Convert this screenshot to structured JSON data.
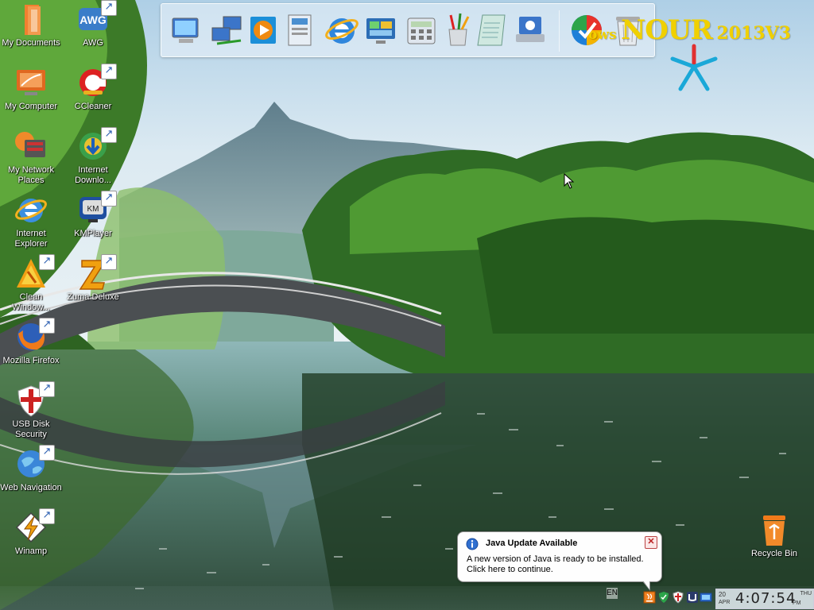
{
  "desktop_icons": {
    "my_documents": "My Documents",
    "awg": "AWG",
    "my_computer": "My Computer",
    "ccleaner": "CCleaner",
    "my_network_places": "My Network Places",
    "internet_download": "Internet Downlo...",
    "internet_explorer": "Internet Explorer",
    "kmplayer": "KMPlayer",
    "clean_windows": "Clean Window...",
    "zuma_deluxe": "Zuma Deluxe",
    "mozilla_firefox": "Mozilla Firefox",
    "usb_disk_security": "USB Disk Security",
    "web_navigation": "Web Navigation",
    "winamp": "Winamp",
    "recycle_bin": "Recycle Bin"
  },
  "dock_icons": [
    "computer-icon",
    "network-icon",
    "media-player-icon",
    "documents-icon",
    "internet-explorer-icon",
    "control-panel-icon",
    "calculator-icon",
    "paint-icon",
    "notepad-icon",
    "disk-cleanup-icon",
    "windows-logo-icon",
    "recycle-bin-icon"
  ],
  "brand": {
    "part1": "ows",
    "part2": "NOUR",
    "part3": "2013V3"
  },
  "notification": {
    "title": "Java Update Available",
    "message": "A new version of Java is ready to be installed. Click here to continue."
  },
  "taskbar": {
    "language": "EN",
    "clock_time": "4:07:54",
    "clock_date": "20",
    "clock_month": "APR",
    "clock_day": "THU",
    "clock_ampm": "PM"
  },
  "colors": {
    "brand_yellow": "#f0d000",
    "sky": "#b9d6ea",
    "balloon_bg": "#fefefe"
  }
}
